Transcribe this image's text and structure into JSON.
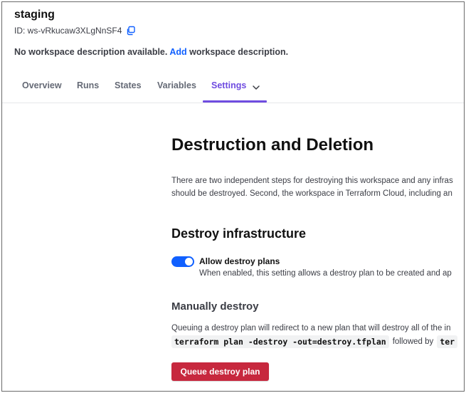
{
  "workspace": {
    "name": "staging",
    "id": "ID: ws-vRkucaw3XLgNnSF4",
    "description_prefix": "No workspace description available.",
    "description_link": "Add",
    "description_suffix": "workspace description."
  },
  "tabs": [
    {
      "label": "Overview",
      "active": false
    },
    {
      "label": "Runs",
      "active": false
    },
    {
      "label": "States",
      "active": false
    },
    {
      "label": "Variables",
      "active": false
    },
    {
      "label": "Settings",
      "active": true
    }
  ],
  "main": {
    "title": "Destruction and Deletion",
    "intro_line1": "There are two independent steps for destroying this workspace and any infras",
    "intro_line2": "should be destroyed. Second, the workspace in Terraform Cloud, including an",
    "destroy_infra": {
      "heading": "Destroy infrastructure",
      "toggle_label": "Allow destroy plans",
      "toggle_on": true,
      "toggle_help": "When enabled, this setting allows a destroy plan to be created and ap"
    },
    "manual": {
      "heading": "Manually destroy",
      "text": "Queuing a destroy plan will redirect to a new plan that will destroy all of the in",
      "command": "terraform plan -destroy -out=destroy.tfplan",
      "followed_by": "followed by",
      "command2": "ter",
      "button_label": "Queue destroy plan"
    }
  },
  "colors": {
    "accent": "#6f4ce0",
    "link": "#1060ff",
    "danger": "#c7283e",
    "toggle": "#1060ff"
  },
  "icons": {
    "copy": "copy-icon",
    "settings_dropdown": "chevron-down-icon"
  }
}
